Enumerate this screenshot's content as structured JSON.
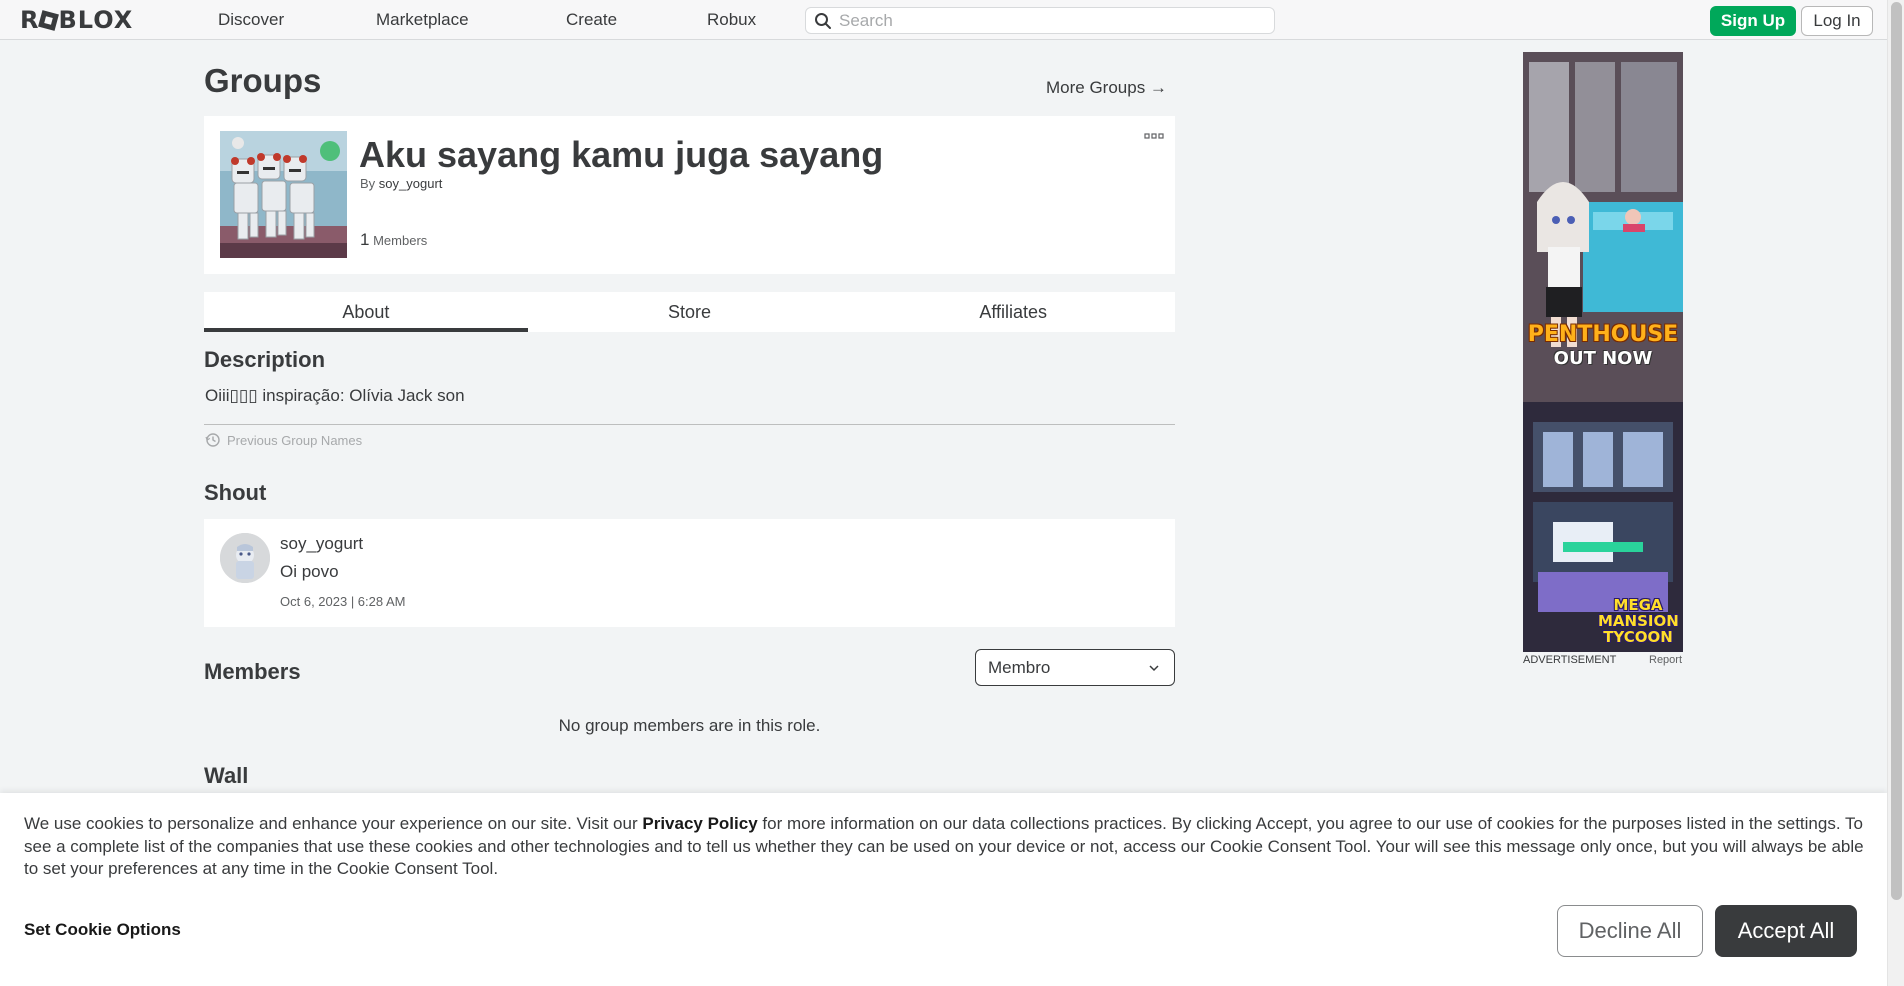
{
  "nav": {
    "logo": "ROBLOX",
    "links": [
      "Discover",
      "Marketplace",
      "Create",
      "Robux"
    ],
    "search_placeholder": "Search",
    "signup_label": "Sign Up",
    "login_label": "Log In"
  },
  "page": {
    "title": "Groups",
    "more_groups": "More Groups →"
  },
  "group": {
    "name": "Aku sayang kamu juga sayang",
    "by_prefix": "By",
    "owner": "soy_yogurt",
    "member_count": "1",
    "members_label": "Members"
  },
  "tabs": [
    "About",
    "Store",
    "Affiliates"
  ],
  "description": {
    "heading": "Description",
    "text": "Oiii▯▯▯ inspiração: Olívia Jack son",
    "previous_names": "Previous Group Names"
  },
  "shout": {
    "heading": "Shout",
    "user": "soy_yogurt",
    "text": "Oi povo",
    "date": "Oct 6, 2023 | 6:28 AM"
  },
  "members": {
    "heading": "Members",
    "role": "Membro",
    "empty": "No group members are in this role."
  },
  "wall": {
    "heading": "Wall"
  },
  "ad": {
    "label": "ADVERTISEMENT",
    "report": "Report",
    "line1": "PENTHOUSE",
    "line2": "OUT NOW",
    "line3": "MEGA MANSION TYCOON"
  },
  "cookie": {
    "text_before": "We use cookies to personalize and enhance your experience on our site. Visit our ",
    "privacy_link": "Privacy Policy",
    "text_after": " for more information on our data collections practices. By clicking Accept, you agree to our use of cookies for the purposes listed in the settings. To see a complete list of the companies that use these cookies and other technologies and to tell us whether they can be used on your device or not, access our Cookie Consent Tool. Your will see this message only once, but you will always be able to set your preferences at any time in the Cookie Consent Tool.",
    "options": "Set Cookie Options",
    "decline": "Decline All",
    "accept": "Accept All"
  },
  "colors": {
    "accent_green": "#00a85a",
    "text_primary": "#393b3d",
    "page_bg": "#f2f4f5"
  }
}
